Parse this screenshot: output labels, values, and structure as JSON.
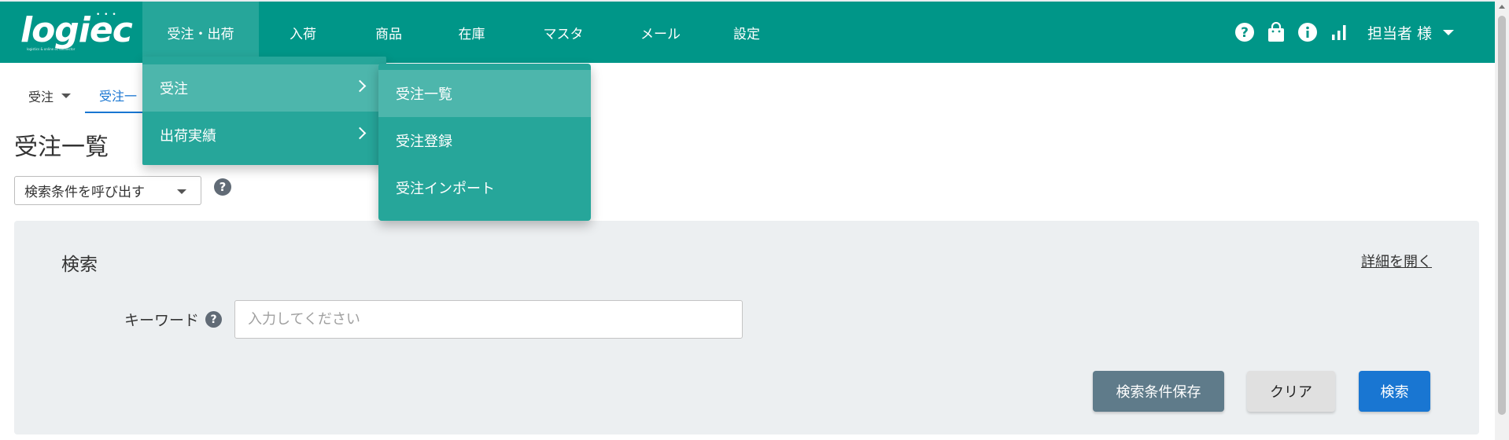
{
  "brand": {
    "logo_text": "logiec",
    "tagline": "logistics & online ec connector"
  },
  "nav": {
    "items": [
      {
        "label": "受注・出荷"
      },
      {
        "label": "入荷"
      },
      {
        "label": "商品"
      },
      {
        "label": "在庫"
      },
      {
        "label": "マスタ"
      },
      {
        "label": "メール"
      },
      {
        "label": "設定"
      }
    ],
    "active_index": 0
  },
  "header_icons": [
    "help-icon",
    "shopping-bag-icon",
    "info-icon",
    "bar-chart-icon"
  ],
  "user": {
    "name": "担当者 様"
  },
  "subtabs": [
    {
      "label": "受注",
      "has_dropdown": true
    },
    {
      "label": "受注一",
      "active": true
    }
  ],
  "page": {
    "title": "受注一覧"
  },
  "saved_search": {
    "label": "検索条件を呼び出す"
  },
  "search": {
    "title": "検索",
    "detail_link": "詳細を開く",
    "keyword_label": "キーワード",
    "keyword_value": "",
    "keyword_placeholder": "入力してください",
    "buttons": {
      "save": "検索条件保存",
      "clear": "クリア",
      "search": "検索"
    }
  },
  "menu_level1": [
    {
      "label": "受注",
      "active": true
    },
    {
      "label": "出荷実績"
    }
  ],
  "menu_level2": [
    {
      "label": "受注一覧",
      "active": true
    },
    {
      "label": "受注登録"
    },
    {
      "label": "受注インポート"
    }
  ],
  "colors": {
    "header": "#009688",
    "menu": "#26a69a",
    "menu_active": "#4db6ac",
    "panel": "#eceff1",
    "primary_button": "#1976d2",
    "secondary_button": "#5f7b8a",
    "clear_button": "#e0e0e0"
  }
}
